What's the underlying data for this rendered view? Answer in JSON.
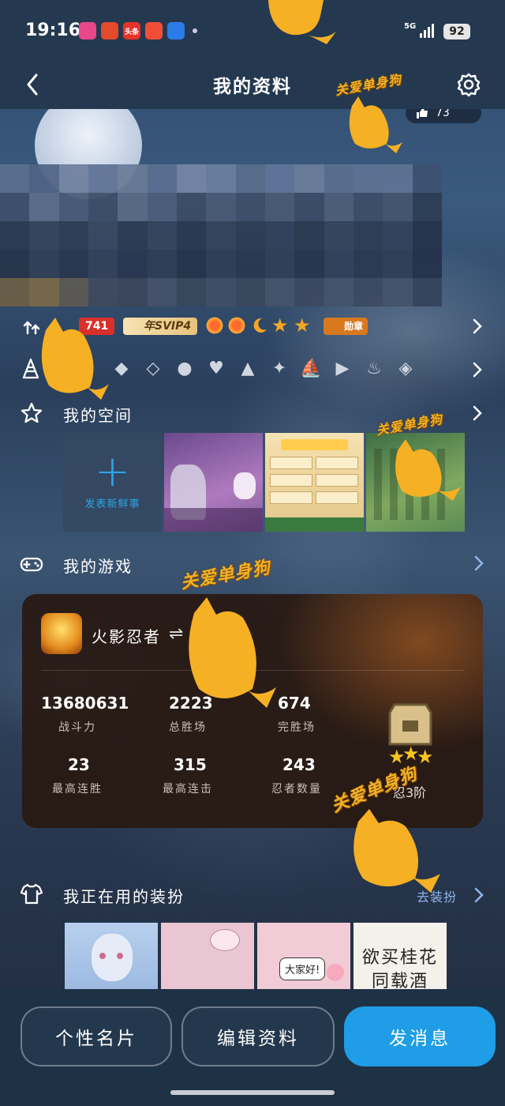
{
  "status_bar": {
    "time": "19:16",
    "network": "5G",
    "battery": "92",
    "notif_icons": [
      "app-icon-1",
      "app-icon-2",
      "头条",
      "app-icon-4",
      "app-icon-5"
    ]
  },
  "nav": {
    "title": "我的资料"
  },
  "profile": {
    "likes": "73"
  },
  "badges_row": {
    "level_number": "741",
    "svip_label": "年SVIP4",
    "medal_label": "勋章"
  },
  "space": {
    "title": "我的空间",
    "add_post_label": "发表新鲜事"
  },
  "games": {
    "title": "我的游戏",
    "game": {
      "name": "火影忍者",
      "stats": [
        {
          "value": "13680631",
          "label": "战斗力"
        },
        {
          "value": "2223",
          "label": "总胜场"
        },
        {
          "value": "674",
          "label": "完胜场"
        },
        {
          "value": "23",
          "label": "最高连胜"
        },
        {
          "value": "315",
          "label": "最高连击"
        },
        {
          "value": "243",
          "label": "忍者数量"
        }
      ],
      "rank_text": "忍3阶"
    }
  },
  "outfit": {
    "title": "我正在用的装扮",
    "action_label": "去装扮",
    "tile3_text": "大家好!",
    "tile4_text": "欲买桂花同载酒"
  },
  "bottom": {
    "card_label": "个性名片",
    "edit_label": "编辑资料",
    "message_label": "发消息"
  },
  "watermark": "关爱单身狗",
  "colors": {
    "accent": "#1f9de6",
    "level_badge": "#d8302b",
    "watermark": "#f0b227"
  }
}
